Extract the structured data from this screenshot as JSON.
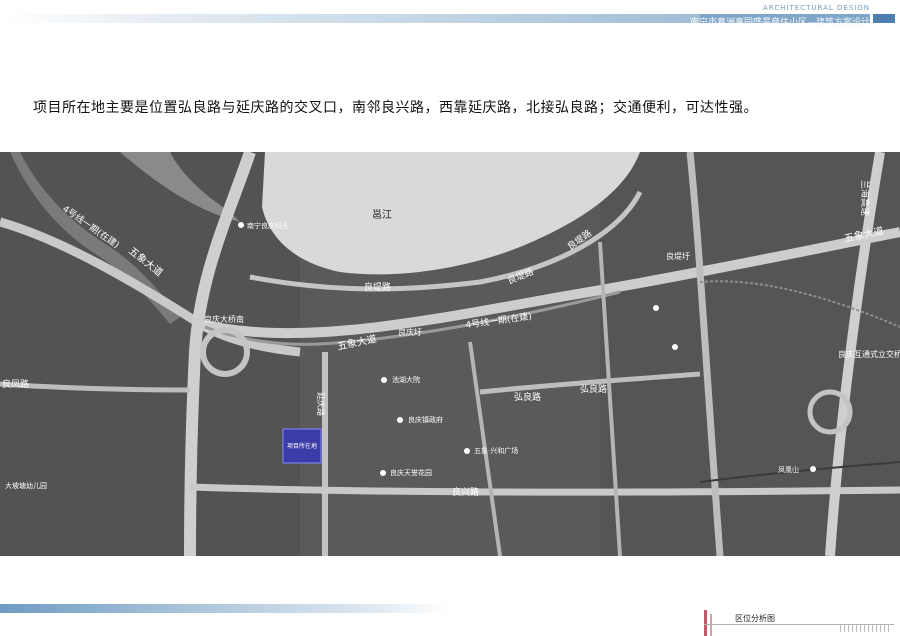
{
  "header": {
    "arch_label": "ARCHITECTURAL DESIGN",
    "title": "南宁市意洲嘉园盛景商住小区",
    "subtitle": "—建筑方案设计"
  },
  "intro_text": "项目所在地主要是位置弘良路与延庆路的交叉口，南邻良兴路，西靠延庆路，北接弘良路；交通便利，可达性强。",
  "map": {
    "river_label": "邕江",
    "site_label": "项目所在地",
    "labels": {
      "line4_left": "4号线一期(在建)",
      "line4_mid": "4号线一期(在建)",
      "wuxiang_left": "五象大道",
      "wuxiang_mid": "五象大道",
      "wuxiang_right": "五象大道",
      "liangti_left": "良堤路",
      "liangti_mid": "良堤路",
      "liangti_upper": "良堤路",
      "hongliang_left": "弘良路",
      "hongliang_right": "弘良路",
      "liangxing": "良兴路",
      "yanqing": "延庆路",
      "liangqing_bridge": "良庆大桥南",
      "liangqing_xu": "良庆圩",
      "liangqing_wharf": "南宁良庆码头",
      "liangtixu": "良堤圩",
      "left_road": "良凤路",
      "yuanhe": "池湖大院",
      "govt": "良庆镇政府",
      "wuxiang_plaza": "五象·兴和广场",
      "tianyu": "良庆天誉花园",
      "kindergarten": "大坡塘幼儿园",
      "interchange": "良庆互通式立交桥",
      "highway": "兰海高速",
      "fenghuang": "凤凰山"
    }
  },
  "footer": {
    "section_label": "区位分析图"
  },
  "colors": {
    "accent_blue": "#4f7fb0",
    "site_fill": "#3c3ca8",
    "accent_red": "#c05a6a"
  }
}
